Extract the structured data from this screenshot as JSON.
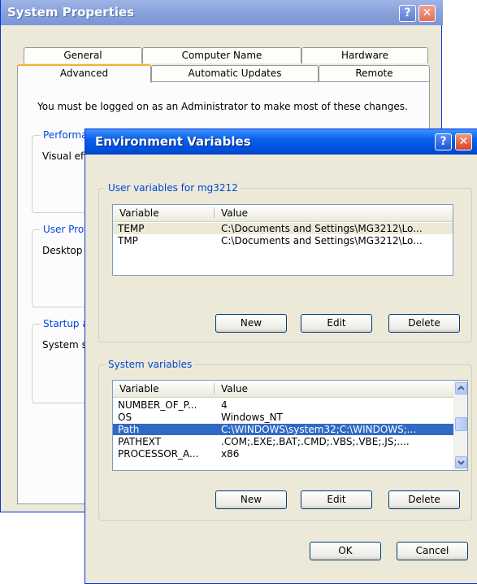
{
  "system_properties": {
    "title": "System Properties",
    "help_glyph": "?",
    "close_glyph": "✕",
    "tabs_row1": [
      "General",
      "Computer Name",
      "Hardware"
    ],
    "tabs_row2": [
      "Advanced",
      "Automatic Updates",
      "Remote"
    ],
    "active_tab": "Advanced",
    "admin_note": "You must be logged on as an Administrator to make most of these changes.",
    "groups": [
      {
        "legend": "Performance",
        "text": "Visual effects"
      },
      {
        "legend": "User Profiles",
        "text": "Desktop"
      },
      {
        "legend": "Startup and Recovery",
        "text": "System startup"
      }
    ]
  },
  "env_vars": {
    "title": "Environment Variables",
    "help_glyph": "?",
    "close_glyph": "✕",
    "user_section": {
      "legend": "User variables for mg3212",
      "col_variable": "Variable",
      "col_value": "Value",
      "rows": [
        {
          "variable": "TEMP",
          "value": "C:\\Documents and Settings\\MG3212\\Lo..."
        },
        {
          "variable": "TMP",
          "value": "C:\\Documents and Settings\\MG3212\\Lo..."
        }
      ],
      "buttons": {
        "new": "New",
        "edit": "Edit",
        "delete": "Delete"
      }
    },
    "system_section": {
      "legend": "System variables",
      "col_variable": "Variable",
      "col_value": "Value",
      "rows": [
        {
          "variable": "NUMBER_OF_P...",
          "value": "4"
        },
        {
          "variable": "OS",
          "value": "Windows_NT"
        },
        {
          "variable": "Path",
          "value": "C:\\WINDOWS\\system32;C:\\WINDOWS;..."
        },
        {
          "variable": "PATHEXT",
          "value": ".COM;.EXE;.BAT;.CMD;.VBS;.VBE;.JS;...."
        },
        {
          "variable": "PROCESSOR_A...",
          "value": "x86"
        }
      ],
      "selected_row": "Path",
      "buttons": {
        "new": "New",
        "edit": "Edit",
        "delete": "Delete"
      }
    },
    "ok_label": "OK",
    "cancel_label": "Cancel"
  },
  "colors": {
    "xp_blue_titlebar": "#0054e3",
    "inactive_titlebar": "#8aa3dd",
    "selection": "#316ac5",
    "group_legend": "#0046d5",
    "dialog_face": "#ece9d8"
  }
}
